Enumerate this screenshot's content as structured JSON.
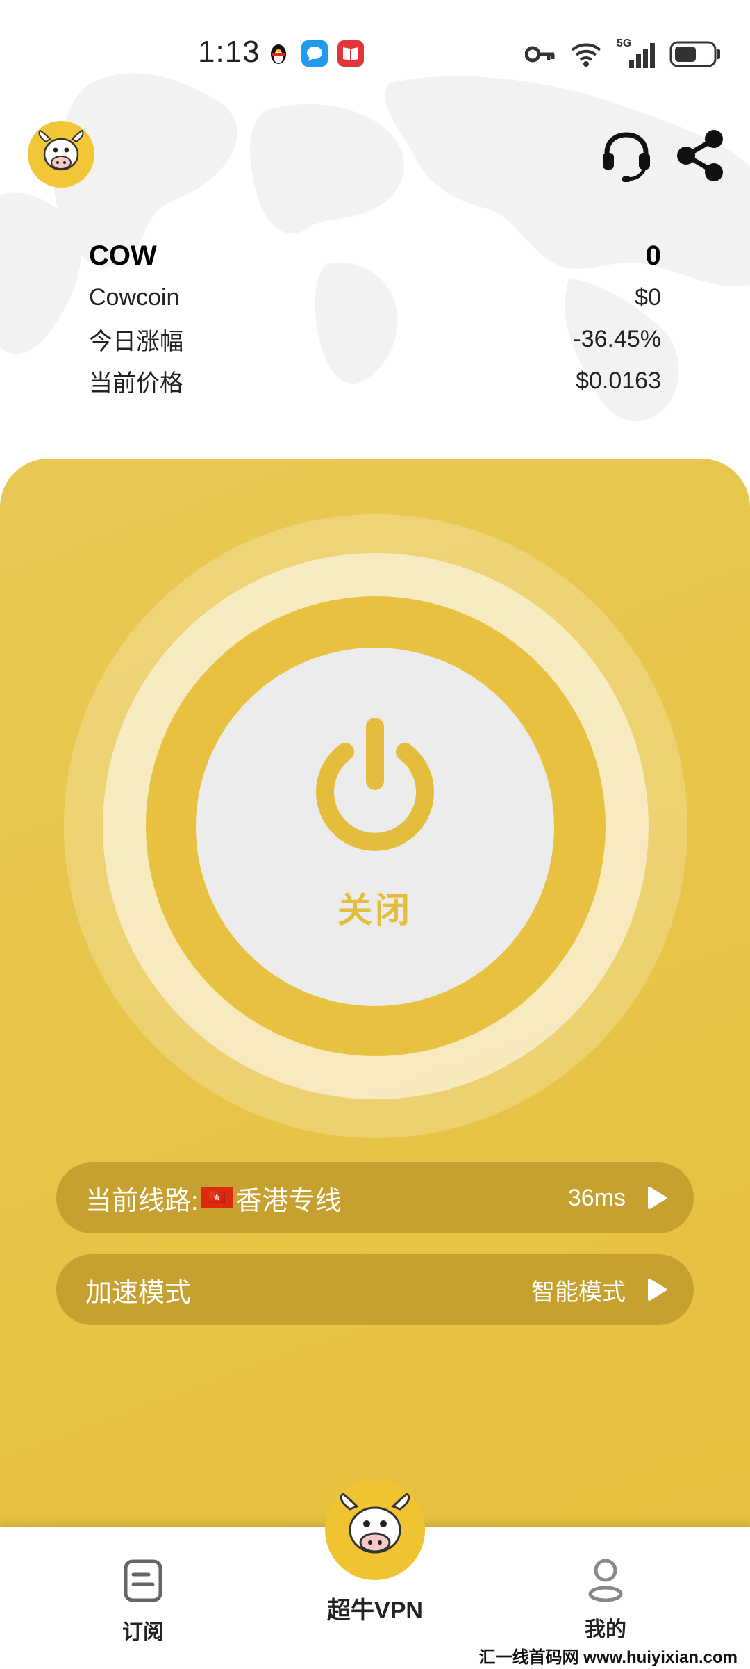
{
  "status_bar": {
    "time": "1:13",
    "network_label": "5G"
  },
  "header": {
    "avatar_icon": "cow-logo-icon",
    "support_icon": "headset-icon",
    "share_icon": "share-icon"
  },
  "coin": {
    "symbol": "COW",
    "balance": "0",
    "name": "Cowcoin",
    "value": "$0",
    "change_label": "今日涨幅",
    "change_value": "-36.45%",
    "price_label": "当前价格",
    "price_value": "$0.0163"
  },
  "power": {
    "state_label": "关闭"
  },
  "route": {
    "label": "当前线路:",
    "flag": "🇭🇰",
    "name": "香港专线",
    "latency": "36ms"
  },
  "mode": {
    "label": "加速模式",
    "value": "智能模式"
  },
  "nav": {
    "subscribe": "订阅",
    "home": "超牛VPN",
    "mine": "我的"
  },
  "watermark": "汇一线首码网 www.huiyixian.com",
  "colors": {
    "accent": "#e8c548",
    "accent_dark": "#c7a12f",
    "power_label": "#e4bd3c"
  }
}
